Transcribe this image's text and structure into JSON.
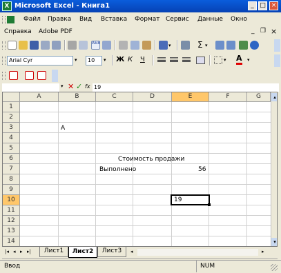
{
  "window": {
    "title": "Microsoft Excel - Книга1",
    "minimize": "_",
    "maximize": "□",
    "close": "×"
  },
  "menus": [
    "Файл",
    "Правка",
    "Вид",
    "Вставка",
    "Формат",
    "Сервис",
    "Данные",
    "Окно"
  ],
  "menus2": [
    "Справка",
    "Adobe PDF"
  ],
  "mdi": {
    "minimize": "_",
    "restore": "❐",
    "close": "×"
  },
  "format_toolbar": {
    "font": "Arial Cyr",
    "size": "10",
    "bold": "Ж",
    "italic": "К",
    "underline": "Ч",
    "font_color_label": "A"
  },
  "sum_symbol": "Σ",
  "formula_bar": {
    "name_box": "",
    "fx": "fx",
    "value": "19"
  },
  "columns": [
    "A",
    "B",
    "C",
    "D",
    "E",
    "F",
    "G"
  ],
  "rows": [
    "1",
    "2",
    "3",
    "4",
    "5",
    "6",
    "7",
    "8",
    "9",
    "10",
    "11",
    "12",
    "13",
    "14"
  ],
  "cells": {
    "B3": "A",
    "C6": "Стоимость продажи",
    "C7": "Выполнено",
    "E7": "56",
    "E10": "19"
  },
  "active_cell": "E10",
  "sheet_tabs": [
    "Лист1",
    "Лист2",
    "Лист3"
  ],
  "active_sheet": "Лист2",
  "status": {
    "mode": "Ввод",
    "num": "NUM"
  },
  "colors": {
    "title_bar": "#0a5ddb",
    "selection_header": "#ffc76a",
    "chrome": "#ece9d8"
  }
}
